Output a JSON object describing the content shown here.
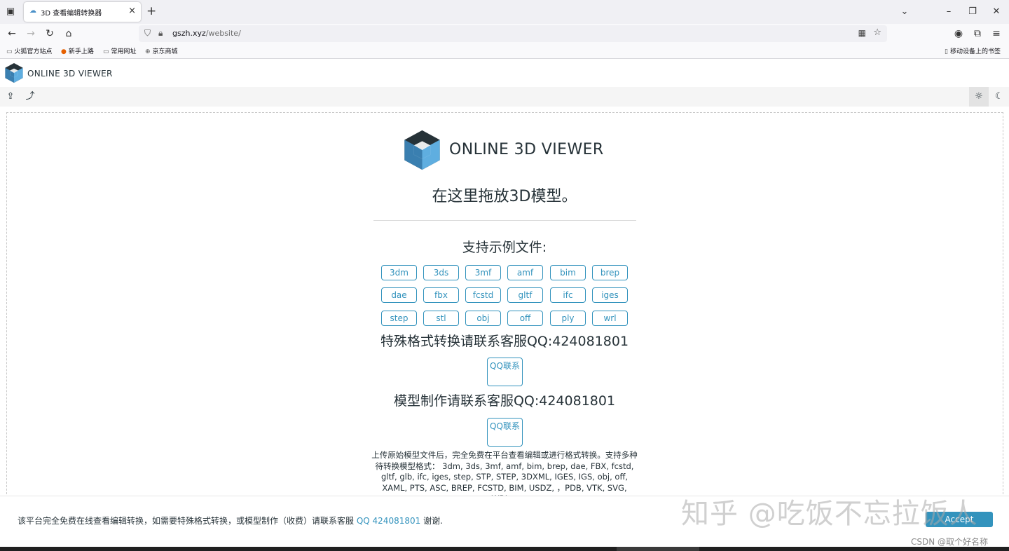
{
  "browser": {
    "tab_title": "3D 查看编辑转换器",
    "url_domain": "gszh.xyz",
    "url_path": "/website/",
    "bookmarks": [
      {
        "label": "火狐官方站点",
        "icon": "folder-icon"
      },
      {
        "label": "新手上路",
        "icon": "firefox-icon"
      },
      {
        "label": "常用网址",
        "icon": "folder-icon"
      },
      {
        "label": "京东商城",
        "icon": "globe-icon"
      }
    ],
    "mobile_bookmarks": "移动设备上的书签"
  },
  "app": {
    "header_title": "ONLINE 3D VIEWER",
    "toolbar": [
      "open-file-icon",
      "open-url-icon"
    ],
    "theme_buttons": [
      "light-mode-icon",
      "dark-mode-icon"
    ]
  },
  "main": {
    "intro_title": "ONLINE 3D VIEWER",
    "drop_text": "在这里拖放3D模型。",
    "examples_title": "支持示例文件:",
    "example_files": [
      "3dm",
      "3ds",
      "3mf",
      "amf",
      "bim",
      "brep",
      "dae",
      "fbx",
      "fcstd",
      "gltf",
      "ifc",
      "iges",
      "step",
      "stl",
      "obj",
      "off",
      "ply",
      "wrl"
    ],
    "special_format_line": "特殊格式转换请联系客服QQ:424081801",
    "qq_button_1": "QQ联系",
    "model_making_line": "模型制作请联系客服QQ:424081801",
    "qq_button_2": "QQ联系",
    "description": "上传原始模型文件后，完全免费在平台查看编辑或进行格式转换。支持多种待转换模型格式： 3dm, 3ds, 3mf, amf, bim, brep, dae, FBX, fcstd, gltf, glb, ifc, iges, step, STP, STEP, 3DXML, IGES, IGS, obj, off, XAML, PTS, ASC, BREP, FCSTD, BIM, USDZ, ，PDB, VTK, SVG, WRL。"
  },
  "notice": {
    "text_before": "该平台完全免费在线查看编辑转换，如需要特殊格式转换，或模型制作（收费）请联系客服 ",
    "link": "QQ 424081801",
    "text_after": " 谢谢.",
    "accept": "Accept"
  },
  "overlay": {
    "watermark": "知乎 @吃饭不忘拉饭人",
    "csdn": "CSDN @取个好名称"
  },
  "colors": {
    "accent": "#3393bd",
    "text": "#263238",
    "logo_dark": "#263238",
    "logo_light": "#5faee0"
  }
}
